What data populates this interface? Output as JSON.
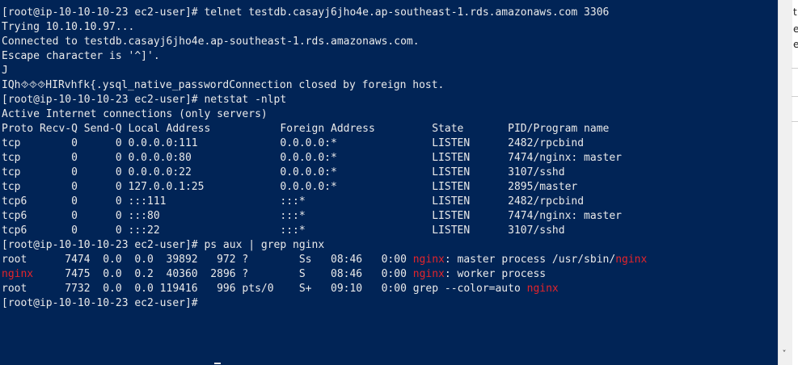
{
  "terminal": {
    "prompt_color": "#eaeaea",
    "highlight_color": "#e5242b",
    "background_color": "#012456",
    "lines": [
      [
        {
          "text": "[root@ip-10-10-10-23 ec2-user]# telnet testdb.casayj6jho4e.ap-southeast-1.rds.amazonaws.com 3306"
        }
      ],
      [
        {
          "text": "Trying 10.10.10.97..."
        }
      ],
      [
        {
          "text": "Connected to testdb.casayj6jho4e.ap-southeast-1.rds.amazonaws.com."
        }
      ],
      [
        {
          "text": "Escape character is '^]'."
        }
      ],
      [
        {
          "text": "J"
        }
      ],
      [
        {
          "text": "IQh⯑⯑⯑HIRvhfk{.ysql_native_passwordConnection closed by foreign host."
        }
      ],
      [
        {
          "text": "[root@ip-10-10-10-23 ec2-user]# netstat -nlpt"
        }
      ],
      [
        {
          "text": "Active Internet connections (only servers)"
        }
      ],
      [
        {
          "text": "Proto Recv-Q Send-Q Local Address           Foreign Address         State       PID/Program name"
        }
      ],
      [
        {
          "text": "tcp        0      0 0.0.0.0:111             0.0.0.0:*               LISTEN      2482/rpcbind"
        }
      ],
      [
        {
          "text": "tcp        0      0 0.0.0.0:80              0.0.0.0:*               LISTEN      7474/nginx: master"
        }
      ],
      [
        {
          "text": "tcp        0      0 0.0.0.0:22              0.0.0.0:*               LISTEN      3107/sshd"
        }
      ],
      [
        {
          "text": "tcp        0      0 127.0.0.1:25            0.0.0.0:*               LISTEN      2895/master"
        }
      ],
      [
        {
          "text": "tcp6       0      0 :::111                  :::*                    LISTEN      2482/rpcbind"
        }
      ],
      [
        {
          "text": "tcp6       0      0 :::80                   :::*                    LISTEN      7474/nginx: master"
        }
      ],
      [
        {
          "text": "tcp6       0      0 :::22                   :::*                    LISTEN      3107/sshd"
        }
      ],
      [
        {
          "text": "[root@ip-10-10-10-23 ec2-user]# ps aux | grep nginx"
        }
      ],
      [
        {
          "text": "root      7474  0.0  0.0  39892   972 ?        Ss   08:46   0:00 "
        },
        {
          "text": "nginx",
          "hl": true
        },
        {
          "text": ": master process /usr/sbin/"
        },
        {
          "text": "nginx",
          "hl": true
        }
      ],
      [
        {
          "text": "nginx",
          "hl": true
        },
        {
          "text": "     7475  0.0  0.2  40360  2896 ?        S    08:46   0:00 "
        },
        {
          "text": "nginx",
          "hl": true
        },
        {
          "text": ": worker process"
        }
      ],
      [
        {
          "text": "root      7732  0.0  0.0 119416   996 pts/0    S+   09:10   0:00 grep --color=auto "
        },
        {
          "text": "nginx",
          "hl": true
        }
      ],
      [
        {
          "text": "[root@ip-10-10-10-23 ec2-user]#"
        }
      ]
    ]
  },
  "side_panel": {
    "letters": [
      "t",
      "e",
      "e"
    ],
    "scroll_down_icon": "chevron-down-icon",
    "scroll_down_glyph": "˅"
  }
}
